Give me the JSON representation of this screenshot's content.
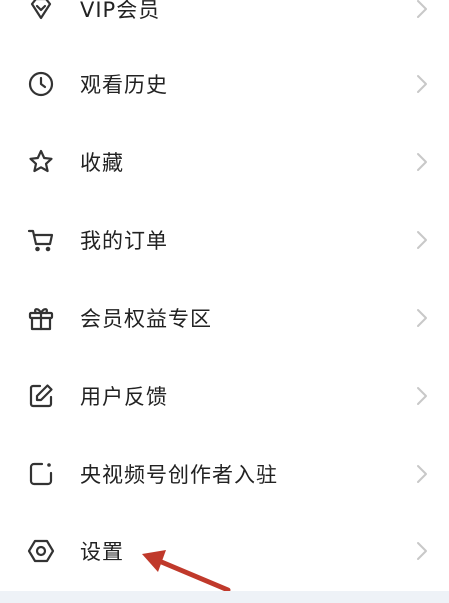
{
  "menu": {
    "items": [
      {
        "label": "VIP会员",
        "icon": "diamond-icon"
      },
      {
        "label": "观看历史",
        "icon": "clock-icon"
      },
      {
        "label": "收藏",
        "icon": "star-icon"
      },
      {
        "label": "我的订单",
        "icon": "cart-icon"
      },
      {
        "label": "会员权益专区",
        "icon": "gift-icon"
      },
      {
        "label": "用户反馈",
        "icon": "edit-icon"
      },
      {
        "label": "央视频号创作者入驻",
        "icon": "creator-icon"
      },
      {
        "label": "设置",
        "icon": "settings-icon"
      }
    ]
  },
  "colors": {
    "text": "#222222",
    "icon": "#333333",
    "chevron": "#c8c8c8",
    "arrow": "#c0392b",
    "background": "#ffffff",
    "bottom_strip": "#eef2f7"
  }
}
